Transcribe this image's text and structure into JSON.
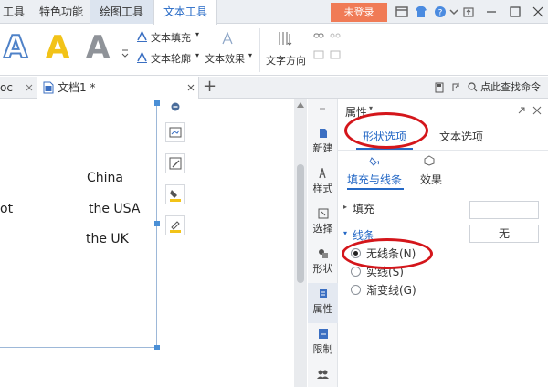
{
  "menu": {
    "tabs": [
      "工具",
      "特色功能",
      "绘图工具",
      "文本工具"
    ],
    "active_tab": "文本工具",
    "login_label": "未登录"
  },
  "ribbon": {
    "text_fill": "文本填充",
    "text_outline": "文本轮廓",
    "text_effect": "文本效果",
    "text_direction": "文字方向",
    "style_letter": "A"
  },
  "tabs": {
    "prev_doc": "oc",
    "current_doc": "文档1 *",
    "search": "点此查找命令"
  },
  "document": {
    "lines": [
      {
        "left": "",
        "right": "China"
      },
      {
        "left": "ot",
        "right": "the USA"
      },
      {
        "left": "",
        "right": "the UK"
      }
    ]
  },
  "sidebar": {
    "items": [
      "新建",
      "样式",
      "选择",
      "形状",
      "属性",
      "限制"
    ]
  },
  "panel": {
    "title": "属性",
    "tab_shape": "形状选项",
    "tab_text": "文本选项",
    "sub_fill_line": "填充与线条",
    "sub_effect": "效果",
    "fill_label": "填充",
    "line_label": "线条",
    "line_value": "无",
    "options": [
      "无线条(N)",
      "实线(S)",
      "渐变线(G)"
    ],
    "selected_option": "无线条(N)"
  },
  "colors": {
    "accent": "#2569c6",
    "annotation": "#d4161b",
    "login": "#f07b56"
  }
}
